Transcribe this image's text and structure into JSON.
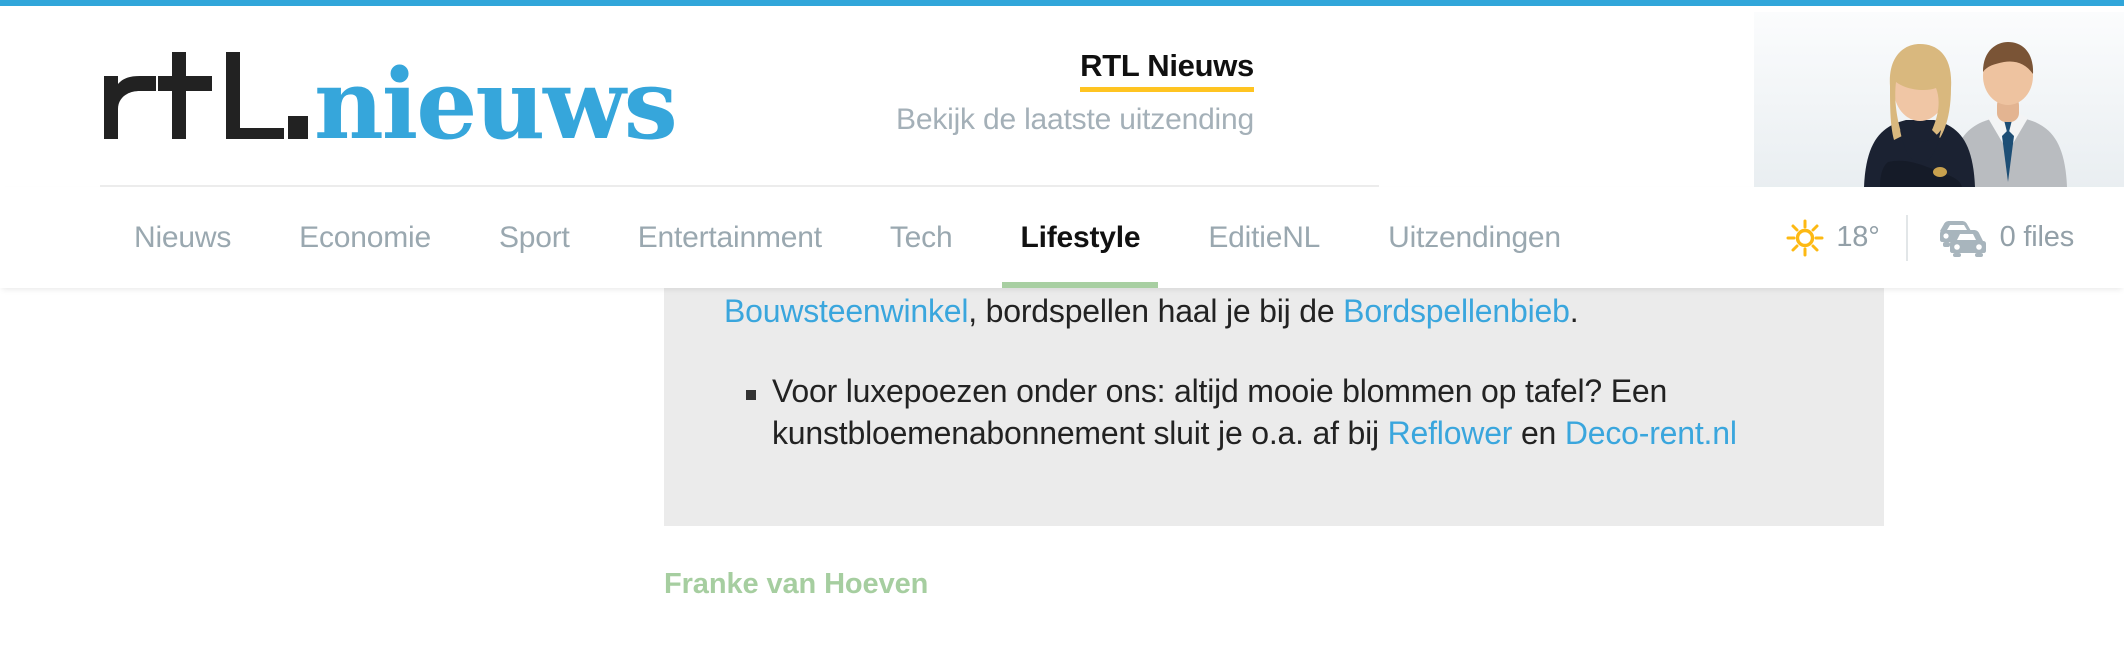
{
  "site": {
    "accent_bar_color": "#31a6da",
    "logo": {
      "mark_text": "rtl",
      "word_text": "nieuws",
      "mark_color": "#222222",
      "word_color": "#36a6db"
    }
  },
  "promo": {
    "title": "RTL Nieuws",
    "subtitle": "Bekijk de laatste uitzending",
    "underline_color": "#ffc421"
  },
  "presenters": {
    "alt": "two-news-presenters-photo"
  },
  "nav": {
    "items": [
      {
        "label": "Nieuws",
        "active": false
      },
      {
        "label": "Economie",
        "active": false
      },
      {
        "label": "Sport",
        "active": false
      },
      {
        "label": "Entertainment",
        "active": false
      },
      {
        "label": "Tech",
        "active": false
      },
      {
        "label": "Lifestyle",
        "active": true
      },
      {
        "label": "EditieNL",
        "active": false
      },
      {
        "label": "Uitzendingen",
        "active": false
      }
    ],
    "active_underline_color": "#a8cfa2",
    "weather": {
      "icon": "sun-icon",
      "icon_color": "#fdb913",
      "value": "18°"
    },
    "traffic": {
      "icon": "cars-traffic-icon",
      "icon_color": "#a8b5bd",
      "value": "0 files"
    }
  },
  "article": {
    "callout": {
      "background": "#ebebeb",
      "paragraph": {
        "link1": "Bouwsteenwinkel",
        "middle": ", bordspellen haal je bij de ",
        "link2": "Bordspellenbieb",
        "end": "."
      },
      "bullets": [
        {
          "part1": "Voor luxepoezen onder ons: altijd mooie blommen op tafel? Een kunstbloemenabonnement sluit je o.a. af bij ",
          "link1": "Reflower",
          "part2": " en ",
          "link2": "Deco-rent.nl"
        }
      ]
    },
    "byline": "Franke van Hoeven",
    "byline_color": "#a6cea0"
  }
}
